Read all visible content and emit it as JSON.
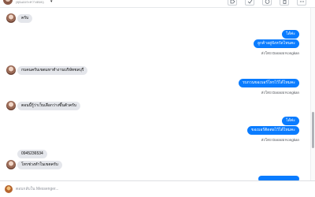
{
  "header": {
    "subtitle": "(คุณเองระหว่างตอบ)"
  },
  "messages": {
    "m1": "ครับ",
    "m2": "ได้ค่ะ",
    "m3": "ลูกค้าอยู่จังหวัดไหนคะ",
    "m4_label": "ส่งโดย",
    "m4_name": "Dararat Kongkan",
    "m5": "กบคนครับเขตมหาทำงานบริษัทชลบุรี",
    "m6": "รบกวนขอเบอร์โทรไว้ได้ไหมคะ",
    "m7_label": "ส่งโดย",
    "m7_name": "Dararat Kongkan",
    "m8": "ตอนนี้รู้ว่าเว็บเลือกว่างขึ้นตัวครับ",
    "m9": "ได้ค่ะ",
    "m10": "ขอเบอร์ติดต่อไว้ได้ไหมคะ",
    "m11_label": "ส่งโดย",
    "m11_name": "Dararat Kongkan",
    "m12": "0945236534",
    "m13": "โทรช่วงทำในเขตครับ"
  },
  "composer": {
    "placeholder": "ตอบกลับใน Messenger..."
  },
  "colors": {
    "outgoing_bubble": "#0a7cff",
    "incoming_bubble": "#e4e6eb"
  }
}
